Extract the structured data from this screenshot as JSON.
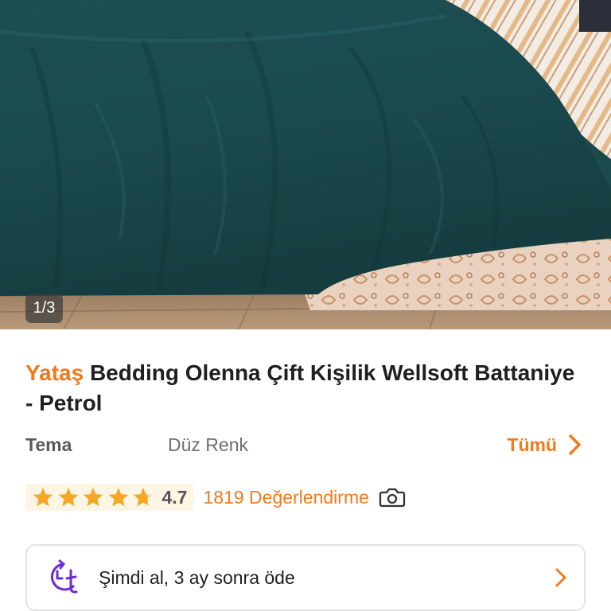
{
  "gallery": {
    "counter": "1/3",
    "image_alt": "Yataş Bedding Olenna Çift Kişilik Wellsoft Battaniye - Petrol"
  },
  "product": {
    "brand": "Yataş",
    "name": "Bedding Olenna Çift Kişilik Wellsoft Battaniye - Petrol"
  },
  "attribute": {
    "key": "Tema",
    "value": "Düz Renk",
    "all_label": "Tümü"
  },
  "rating": {
    "value": "4.7",
    "stars_filled": 4.7,
    "stars_total": 5,
    "review_count_label": "1819 Değerlendirme"
  },
  "installment": {
    "text": "Şimdi al, 3 ay sonra öde"
  },
  "colors": {
    "accent": "#f27a1a",
    "star": "#f5a623",
    "rating_bg": "#fdf5e3",
    "installment_icon": "#6c2bd9"
  },
  "icons": {
    "attr_chevron": "chevron-right-icon",
    "camera": "camera-icon",
    "installment": "installment-clock-icon",
    "card_chevron": "chevron-right-icon"
  }
}
